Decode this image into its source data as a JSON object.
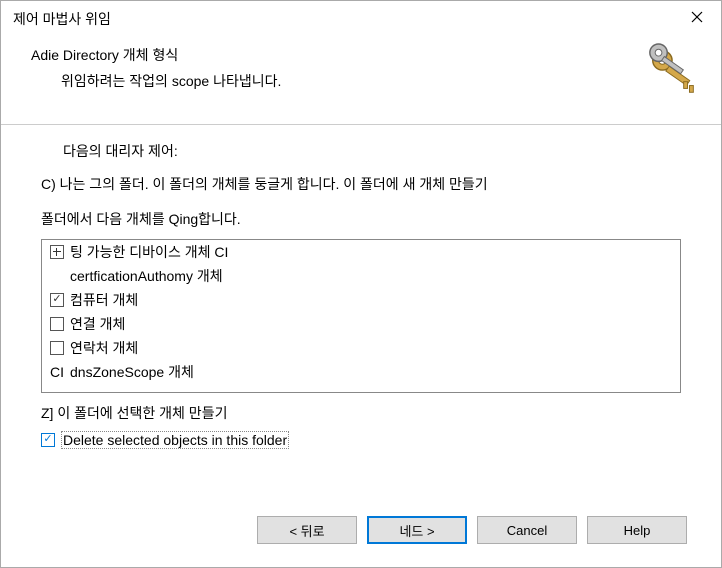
{
  "window": {
    "title": "제어 마법사 위임"
  },
  "header": {
    "heading": "Adie Directory 개체 형식",
    "sub": "위임하려는 작업의 scope 나타냅니다."
  },
  "content": {
    "line1": "다음의 대리자 제어:",
    "line2": "C) 나는 그의 폴더. 이 폴더의 개체를 둥글게 합니다. 이 폴더에 새 개체 만들기",
    "line3": "폴더에서 다음 개체를 Qing합니다.",
    "list": [
      {
        "label": "팅 가능한 디바이스 개체 CI",
        "checked": false,
        "special": true
      },
      {
        "label": "certficationAuthomy 개체",
        "checked": false,
        "nochk": true,
        "indent": true
      },
      {
        "label": "컴퓨터 개체",
        "checked": true
      },
      {
        "label": "연결 개체",
        "checked": false
      },
      {
        "label": "연락처 개체",
        "checked": false
      },
      {
        "label": "dnsZoneScope 개체",
        "checked": false,
        "prefix": "CI",
        "nochk": true
      }
    ],
    "line4": "Z] 이 폴더에 선택한 개체 만들기",
    "delete_chk": {
      "label": "Delete selected objects in this folder",
      "checked": true
    }
  },
  "buttons": {
    "back": "< 뒤로",
    "next": "네드 &gt;",
    "cancel": "Cancel",
    "help": "Help"
  }
}
